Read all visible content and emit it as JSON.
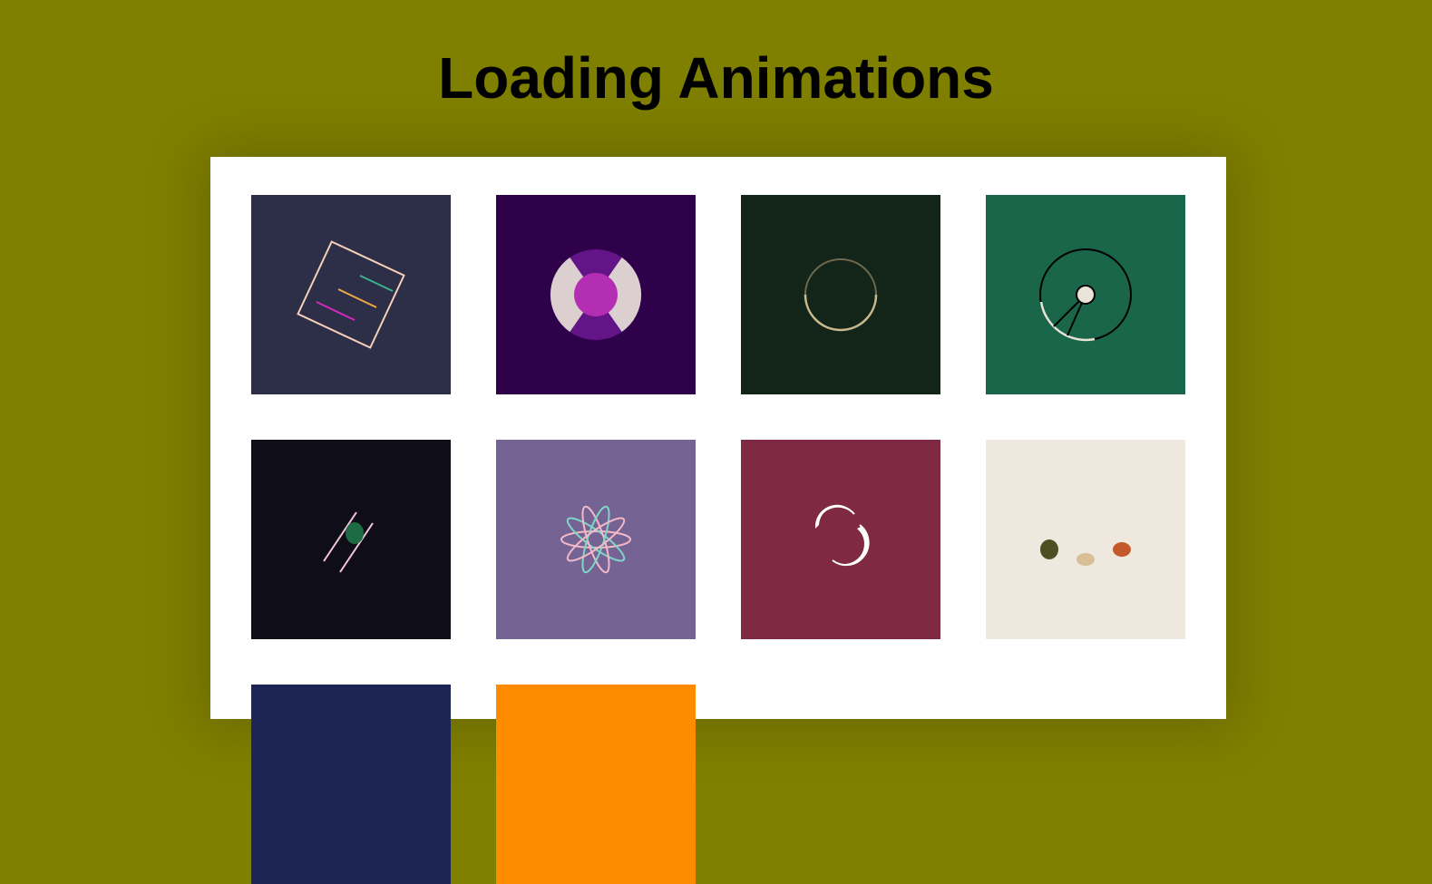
{
  "page": {
    "title": "Loading Animations",
    "background": "#7f7f00",
    "panel_background": "#ffffff"
  },
  "loaders": [
    {
      "name": "rotating-square-lines",
      "background": "#2d2e47",
      "accents": [
        "#f5d0b8",
        "#3db187",
        "#f2a94b",
        "#d12ab8"
      ]
    },
    {
      "name": "pie-segments",
      "background": "#2e014a",
      "accents": [
        "#631487",
        "#dbcfd0",
        "#b42eb3"
      ]
    },
    {
      "name": "thin-ring",
      "background": "#132519",
      "accents": [
        "#b4a47a"
      ]
    },
    {
      "name": "orbit-pendulum",
      "background": "#19664a",
      "accents": [
        "#000000",
        "#e9e4d8"
      ]
    },
    {
      "name": "bouncing-ball-lines",
      "background": "#0f0e18",
      "accents": [
        "#f6c7d6",
        "#1e6a45"
      ]
    },
    {
      "name": "petal-orbits",
      "background": "#746393",
      "accents": [
        "#f4b8c7",
        "#7fd6c7"
      ]
    },
    {
      "name": "crescent-swirl",
      "background": "#7f2943",
      "accents": [
        "#ffffff"
      ]
    },
    {
      "name": "three-dots",
      "background": "#efe8de",
      "accents": [
        "#4e5024",
        "#d9bf98",
        "#c3582b"
      ]
    },
    {
      "name": "navy-tile",
      "background": "#1b2452",
      "accents": []
    },
    {
      "name": "orange-tile",
      "background": "#ff8c00",
      "accents": []
    }
  ]
}
